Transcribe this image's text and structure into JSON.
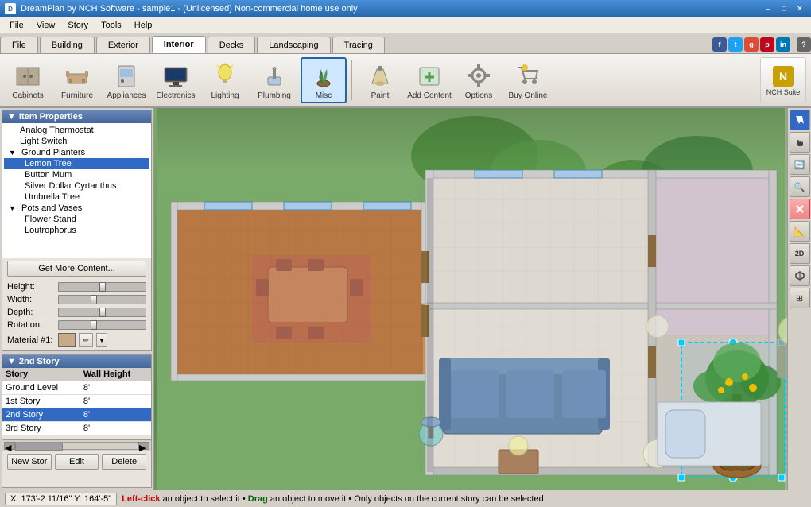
{
  "titlebar": {
    "title": "DreamPlan by NCH Software - sample1 - (Unlicensed) Non-commercial home use only",
    "icon_label": "D",
    "min": "–",
    "max": "□",
    "close": "✕"
  },
  "menubar": {
    "items": [
      "File",
      "View",
      "Story",
      "Tools",
      "Help"
    ]
  },
  "tabs": {
    "items": [
      "File",
      "Building",
      "Exterior",
      "Interior",
      "Decks",
      "Landscaping",
      "Tracing"
    ],
    "active": "Interior"
  },
  "toolbar": {
    "buttons": [
      {
        "id": "cabinets",
        "label": "Cabinets",
        "icon": "🗄"
      },
      {
        "id": "furniture",
        "label": "Furniture",
        "icon": "🪑"
      },
      {
        "id": "appliances",
        "label": "Appliances",
        "icon": "🔲"
      },
      {
        "id": "electronics",
        "label": "Electronics",
        "icon": "📺"
      },
      {
        "id": "lighting",
        "label": "Lighting",
        "icon": "💡"
      },
      {
        "id": "plumbing",
        "label": "Plumbing",
        "icon": "🚿"
      },
      {
        "id": "misc",
        "label": "Misc",
        "icon": "🌿"
      },
      {
        "id": "paint",
        "label": "Paint",
        "icon": "🖌"
      },
      {
        "id": "add-content",
        "label": "Add Content",
        "icon": "📦"
      },
      {
        "id": "options",
        "label": "Options",
        "icon": "⚙"
      },
      {
        "id": "buy-online",
        "label": "Buy Online",
        "icon": "🛒"
      }
    ],
    "active": "misc",
    "nch_label": "NCH Suite"
  },
  "item_properties": {
    "header": "Item Properties",
    "tree": [
      {
        "id": "analog-thermostat",
        "label": "Analog Thermostat",
        "level": 1,
        "selected": false
      },
      {
        "id": "light-switch",
        "label": "Light Switch",
        "level": 1,
        "selected": false
      },
      {
        "id": "ground-planters",
        "label": "Ground Planters",
        "level": 0,
        "group": true
      },
      {
        "id": "lemon-tree",
        "label": "Lemon Tree",
        "level": 1,
        "selected": true
      },
      {
        "id": "button-mum",
        "label": "Button Mum",
        "level": 1,
        "selected": false
      },
      {
        "id": "silver-dollar",
        "label": "Silver Dollar Cyrtanthus",
        "level": 1,
        "selected": false
      },
      {
        "id": "umbrella-tree",
        "label": "Umbrella Tree",
        "level": 1,
        "selected": false
      },
      {
        "id": "pots-and-vases",
        "label": "Pots and Vases",
        "level": 0,
        "group": true
      },
      {
        "id": "flower-stand",
        "label": "Flower Stand",
        "level": 1,
        "selected": false
      },
      {
        "id": "loutrophorus",
        "label": "Loutrophorus",
        "level": 1,
        "selected": false
      }
    ],
    "get_more_btn": "Get More Content...",
    "props": {
      "height": {
        "label": "Height:",
        "value": 50
      },
      "width": {
        "label": "Width:",
        "value": 50
      },
      "depth": {
        "label": "Depth:",
        "value": 50
      },
      "rotation": {
        "label": "Rotation:",
        "value": 45
      }
    },
    "material_label": "Material #1:"
  },
  "story_panel": {
    "header": "2nd Story",
    "columns": [
      "Story",
      "Wall Height"
    ],
    "rows": [
      {
        "story": "Ground Level",
        "height": "8'",
        "selected": false
      },
      {
        "story": "1st Story",
        "height": "8'",
        "selected": false
      },
      {
        "story": "2nd Story",
        "height": "8'",
        "selected": true
      },
      {
        "story": "3rd Story",
        "height": "8'",
        "selected": false
      }
    ],
    "buttons": {
      "new": "New Stor",
      "edit": "Edit",
      "delete": "Delete"
    }
  },
  "right_toolbar": {
    "buttons": [
      {
        "id": "cursor",
        "icon": "↖",
        "label": "cursor-tool"
      },
      {
        "id": "navigate",
        "icon": "✋",
        "label": "navigate-tool"
      },
      {
        "id": "orbit",
        "icon": "🔄",
        "label": "orbit-tool"
      },
      {
        "id": "zoom",
        "icon": "🔍",
        "label": "zoom-tool"
      },
      {
        "id": "pan",
        "icon": "✕",
        "label": "pan-tool"
      },
      {
        "id": "measure",
        "icon": "📏",
        "label": "measure-tool"
      },
      {
        "id": "2d",
        "icon": "2D",
        "label": "2d-view"
      },
      {
        "id": "iso",
        "icon": "⬡",
        "label": "iso-view"
      },
      {
        "id": "grid",
        "icon": "⊞",
        "label": "grid-toggle"
      }
    ]
  },
  "statusbar": {
    "coords": "X: 173'-2 11/16\"  Y: 164'-5\"",
    "message_parts": [
      {
        "text": "Left-click",
        "type": "highlight"
      },
      {
        "text": " an object to select it • ",
        "type": "normal"
      },
      {
        "text": "Drag",
        "type": "drag"
      },
      {
        "text": " an object to move it • Only objects on the current story can be selected",
        "type": "normal"
      }
    ]
  },
  "social": {
    "icons": [
      {
        "id": "fb",
        "label": "f",
        "bg": "#3b5998"
      },
      {
        "id": "tw",
        "label": "t",
        "bg": "#1da1f2"
      },
      {
        "id": "gp",
        "label": "g",
        "bg": "#dd4b39"
      },
      {
        "id": "pi",
        "label": "p",
        "bg": "#bd081c"
      },
      {
        "id": "li",
        "label": "in",
        "bg": "#0077b5"
      }
    ],
    "help": "?"
  }
}
